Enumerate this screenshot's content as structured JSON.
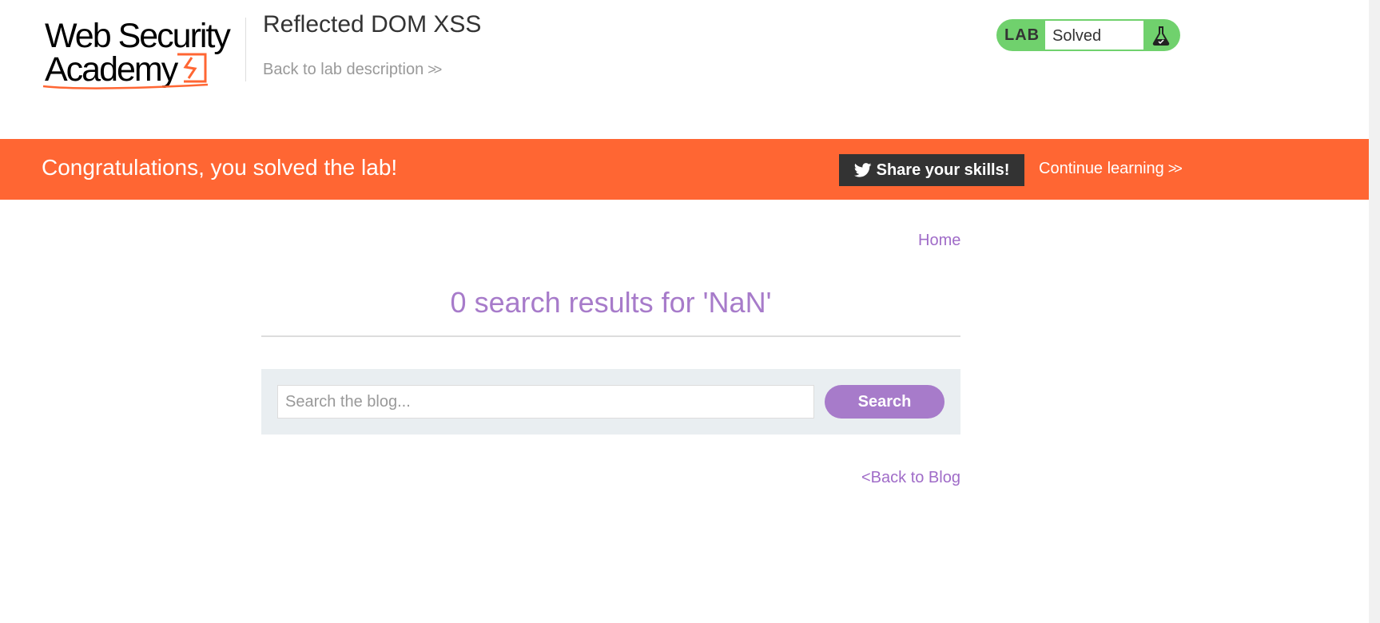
{
  "header": {
    "logo": {
      "line1": "Web Security",
      "line2": "Academy"
    },
    "lab_title": "Reflected DOM XSS",
    "back_to_description": "Back to lab description",
    "status": {
      "label": "LAB",
      "value": "Solved",
      "color": "#70d16d",
      "icon": "flask-icon"
    }
  },
  "banner": {
    "message": "Congratulations, you solved the lab!",
    "share_label": "Share your skills!",
    "share_icon": "twitter-icon",
    "continue_label": "Continue learning",
    "color": "#ff6633"
  },
  "nav": {
    "home": "Home"
  },
  "main": {
    "results_heading": "0 search results for 'NaN'",
    "search": {
      "placeholder": "Search the blog...",
      "value": "",
      "button_label": "Search"
    },
    "back_link": "<Back to Blog"
  },
  "colors": {
    "accent": "#a77bca",
    "link": "#a06cc8",
    "search_panel": "#e9eef1"
  }
}
